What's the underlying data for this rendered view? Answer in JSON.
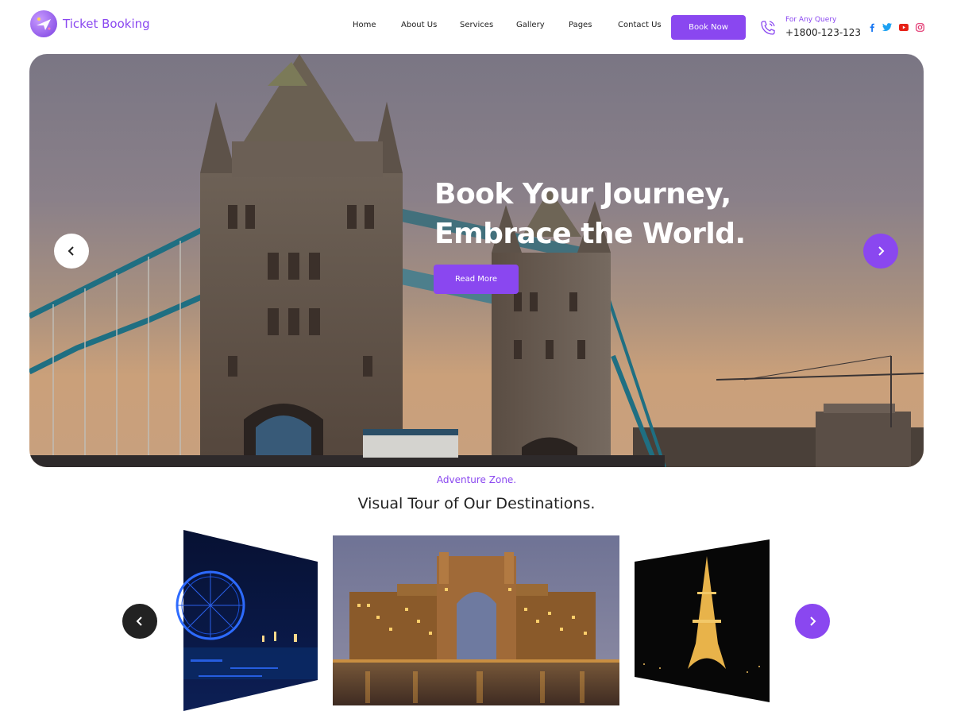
{
  "header": {
    "brand": "Ticket Booking",
    "nav": [
      {
        "label": "Home"
      },
      {
        "label": "About Us"
      },
      {
        "label": "Services"
      },
      {
        "label": "Gallery"
      },
      {
        "label": "Pages"
      },
      {
        "label": "Contact Us"
      }
    ],
    "book_now": "Book Now",
    "query_label": "For Any Query",
    "query_phone": "+1800-123-123",
    "social_icons": [
      "facebook-icon",
      "twitter-icon",
      "youtube-icon",
      "instagram-icon"
    ]
  },
  "hero": {
    "title_line1": "Book Your Journey,",
    "title_line2": "Embrace the World.",
    "cta": "Read More"
  },
  "gallery": {
    "tag": "Adventure Zone.",
    "title": "Visual Tour of Our Destinations."
  },
  "colors": {
    "accent": "#8a47f0",
    "dark": "#222222"
  }
}
